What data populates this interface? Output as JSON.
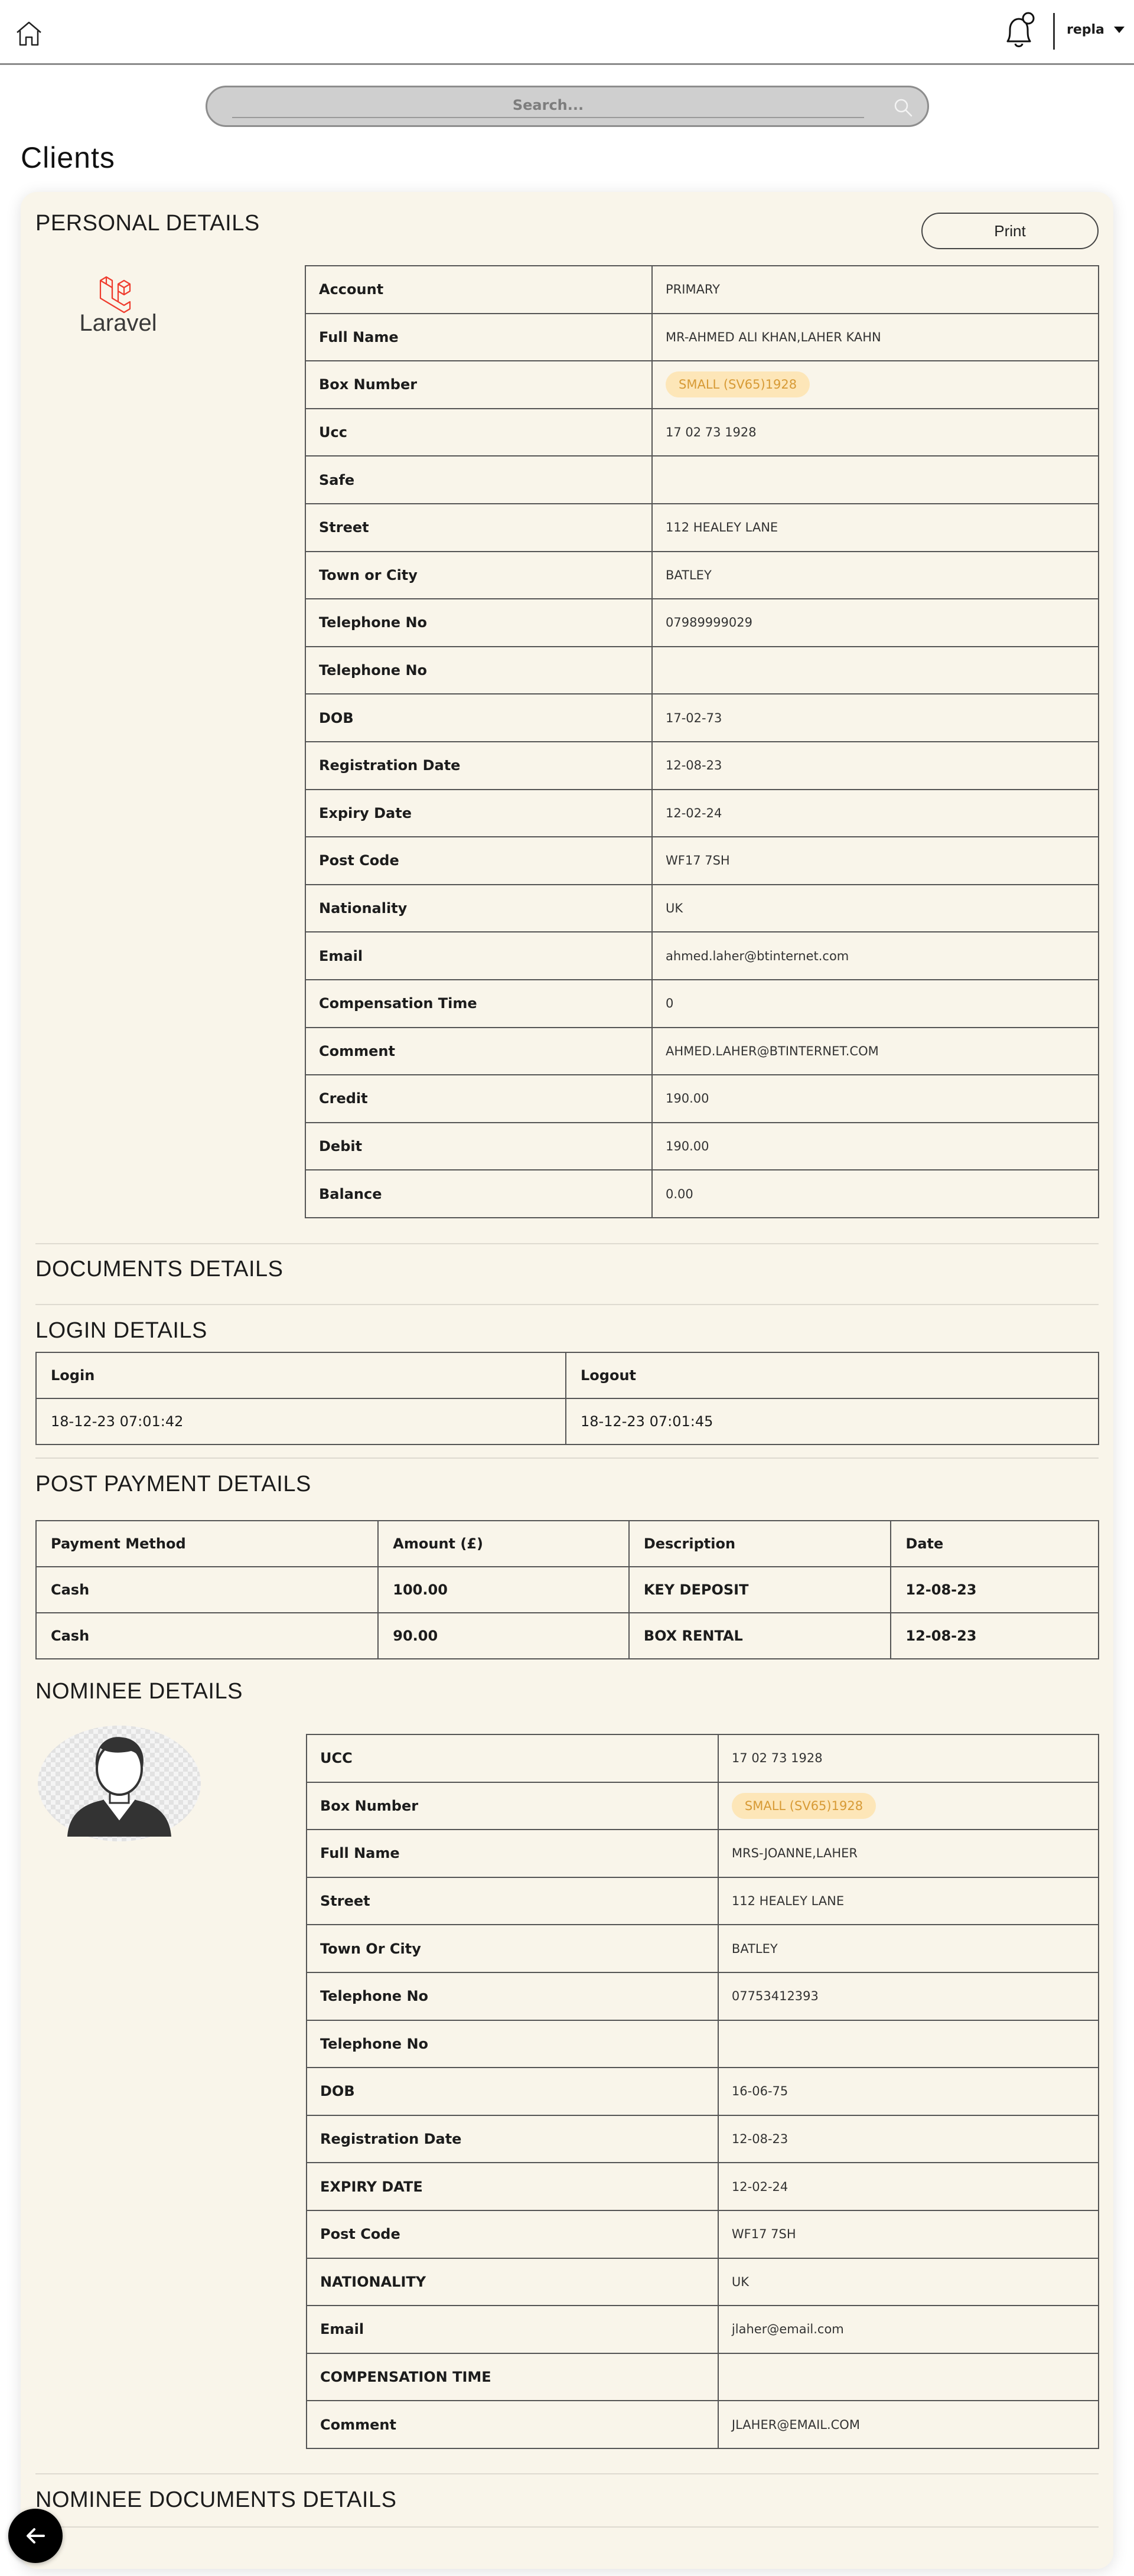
{
  "topbar": {
    "user_name": "repla"
  },
  "search": {
    "placeholder": "Search..."
  },
  "page": {
    "title": "Clients"
  },
  "personal": {
    "title": "PERSONAL DETAILS",
    "print_label": "Print",
    "logo_text": "Laravel",
    "rows": [
      {
        "label": "Account",
        "value": "PRIMARY"
      },
      {
        "label": "Full Name",
        "value": "MR-AHMED ALI KHAN,LAHER KAHN"
      },
      {
        "label": "Box Number",
        "value": "SMALL (SV65)1928",
        "badge": true
      },
      {
        "label": "Ucc",
        "value": "17 02 73 1928"
      },
      {
        "label": "Safe",
        "value": ""
      },
      {
        "label": "Street",
        "value": "112 HEALEY LANE"
      },
      {
        "label": "Town or City",
        "value": "BATLEY"
      },
      {
        "label": "Telephone No",
        "value": "07989999029"
      },
      {
        "label": "Telephone No",
        "value": ""
      },
      {
        "label": "DOB",
        "value": "17-02-73"
      },
      {
        "label": "Registration Date",
        "value": "12-08-23"
      },
      {
        "label": "Expiry Date",
        "value": "12-02-24"
      },
      {
        "label": "Post Code",
        "value": "WF17 7SH"
      },
      {
        "label": "Nationality",
        "value": "UK"
      },
      {
        "label": "Email",
        "value": "ahmed.laher@btinternet.com"
      },
      {
        "label": "Compensation Time",
        "value": "0"
      },
      {
        "label": "Comment",
        "value": "AHMED.LAHER@BTINTERNET.COM"
      },
      {
        "label": "Credit",
        "value": "190.00"
      },
      {
        "label": "Debit",
        "value": "190.00"
      },
      {
        "label": "Balance",
        "value": "0.00"
      }
    ]
  },
  "documents": {
    "title": "DOCUMENTS DETAILS"
  },
  "login": {
    "title": "LOGIN DETAILS",
    "columns": [
      "Login",
      "Logout"
    ],
    "rows": [
      [
        "18-12-23 07:01:42",
        "18-12-23 07:01:45"
      ]
    ]
  },
  "post_payment": {
    "title": "POST PAYMENT DETAILS",
    "columns": [
      "Payment Method",
      "Amount (£)",
      "Description",
      "Date"
    ],
    "rows": [
      [
        "Cash",
        "100.00",
        "KEY DEPOSIT",
        "12-08-23"
      ],
      [
        "Cash",
        "90.00",
        "BOX RENTAL",
        "12-08-23"
      ]
    ]
  },
  "nominee": {
    "title": "NOMINEE DETAILS",
    "rows": [
      {
        "label": "UCC",
        "value": "17 02 73 1928"
      },
      {
        "label": "Box Number",
        "value": "SMALL (SV65)1928",
        "badge": true
      },
      {
        "label": "Full Name",
        "value": "MRS-JOANNE,LAHER"
      },
      {
        "label": "Street",
        "value": "112 HEALEY LANE"
      },
      {
        "label": "Town Or City",
        "value": "BATLEY"
      },
      {
        "label": "Telephone No",
        "value": "07753412393"
      },
      {
        "label": "Telephone No",
        "value": ""
      },
      {
        "label": "DOB",
        "value": "16-06-75"
      },
      {
        "label": "Registration Date",
        "value": "12-08-23"
      },
      {
        "label": "EXPIRY DATE",
        "value": "12-02-24"
      },
      {
        "label": "Post Code",
        "value": "WF17 7SH"
      },
      {
        "label": "NATIONALITY",
        "value": "UK"
      },
      {
        "label": "Email",
        "value": "jlaher@email.com"
      },
      {
        "label": "COMPENSATION TIME",
        "value": ""
      },
      {
        "label": "Comment",
        "value": "JLAHER@EMAIL.COM"
      }
    ]
  },
  "nominee_documents": {
    "title": "NOMINEE DOCUMENTS DETAILS"
  },
  "colors": {
    "card_bg": "#f9f5ea",
    "badge_bg": "#fde6b8",
    "badge_text": "#d79a35",
    "logo_red": "#ef3b2d"
  },
  "icons": {
    "home": "home-icon",
    "bell": "bell-icon",
    "search": "search-icon",
    "back": "arrow-left-icon"
  }
}
